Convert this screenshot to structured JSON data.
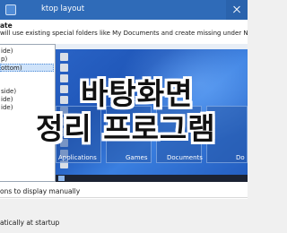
{
  "window": {
    "title": "ktop layout"
  },
  "section_label": "ate",
  "description": "will use existing special folders like My Documents and create missing under Nimi Places data",
  "layouts": [
    {
      "label": "ide)",
      "selected": false
    },
    {
      "label": "p)",
      "selected": false
    },
    {
      "label": "ottom)",
      "selected": true
    },
    {
      "label": "side)",
      "selected": false
    },
    {
      "label": "ide)",
      "selected": false
    },
    {
      "label": "ide)",
      "selected": false
    }
  ],
  "preview": {
    "fences": [
      {
        "label": "Applications"
      },
      {
        "label": "Games"
      },
      {
        "label": "Documents"
      },
      {
        "label": "Do"
      }
    ]
  },
  "overlay": {
    "line1": "바탕화면",
    "line2": "정리 프로그램"
  },
  "manual_label": "ons to display manually",
  "startup_option": "atically at startup",
  "colors": {
    "titlebar": "#2f6bb8",
    "desktop": "#2a64c6",
    "selection": "#cfe3fa"
  }
}
